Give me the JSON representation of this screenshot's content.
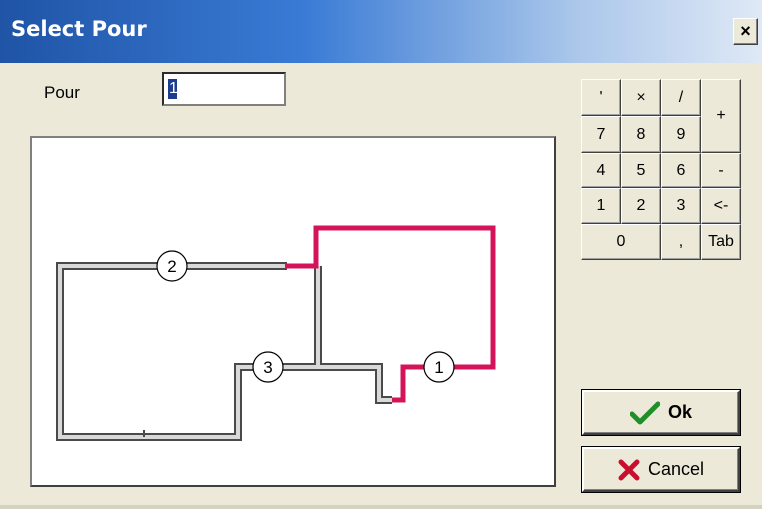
{
  "window": {
    "title": "Select Pour",
    "close_label": "×"
  },
  "pour": {
    "label": "Pour",
    "value": "1"
  },
  "keypad": {
    "keys": [
      "'",
      "×",
      "/",
      "+",
      "7",
      "8",
      "9",
      "4",
      "5",
      "6",
      "-",
      "1",
      "2",
      "3",
      "<-",
      "0",
      ",",
      "Tab"
    ]
  },
  "drawing": {
    "markers": [
      "1",
      "2",
      "3"
    ],
    "colors": {
      "highlight": "#d4145a",
      "outline": "#4a4a4a",
      "fill": "#d9d9d9"
    }
  },
  "buttons": {
    "ok_label": "Ok",
    "cancel_label": "Cancel"
  }
}
